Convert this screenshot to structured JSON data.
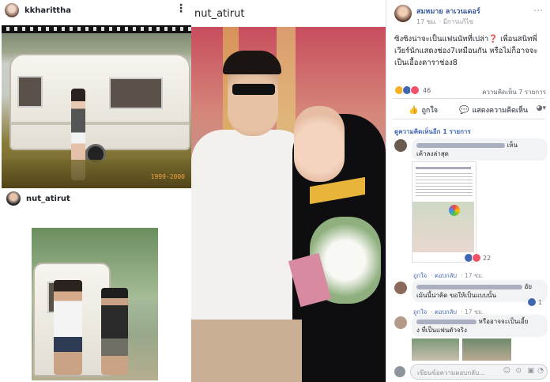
{
  "left": {
    "post1": {
      "username": "kkharittha",
      "film_year": "1999-2000"
    },
    "post2": {
      "username": "nut_atirut"
    }
  },
  "middle": {
    "username": "nut_atirut"
  },
  "facebook": {
    "author": "สมหมาย ลาเวนเดอร์",
    "time": "17 ชม.",
    "place": "มีการแก้ไข",
    "text": "ซิงซิงน่าจะเป็นแฟนนัทที่เปล่า❓ เพื่อนสนิทพี่เวียร์นักแสดงช่อง7เหมือนกัน หรือไม่ก็อาจจะเป็นเอื้องดาราช่อง8",
    "reactions_count": "46",
    "comments_count": "ความคิดเห็น 7 รายการ",
    "like_btn": "ถูกใจ",
    "comment_btn": "แสดงความคิดเห็น",
    "more_comments": "ดูความคิดเห็นอีก 1 รายการ",
    "c1": {
      "text_tail": "เห็น",
      "text_line2": "เค้าลงล่าสุด",
      "like": "ถูกใจ",
      "reply": "ตอบกลับ",
      "time": "17 ชม.",
      "reaction_count": "22"
    },
    "c2": {
      "text_tail": "อัย",
      "text_line2": "เม้นนี้น่าคิด ขอให้เป็นแบบนั้น",
      "like": "ถูกใจ",
      "reply": "ตอบกลับ",
      "time": "17 ชม.",
      "reaction_count": "1"
    },
    "c3": {
      "text_tail": "หรืออาจจะเป็นเอี้ย",
      "text_line2": "ง ที่เป็นแฟนตัวจริง"
    },
    "input_placeholder": "เขียนข้อความตอบกลับ..."
  }
}
